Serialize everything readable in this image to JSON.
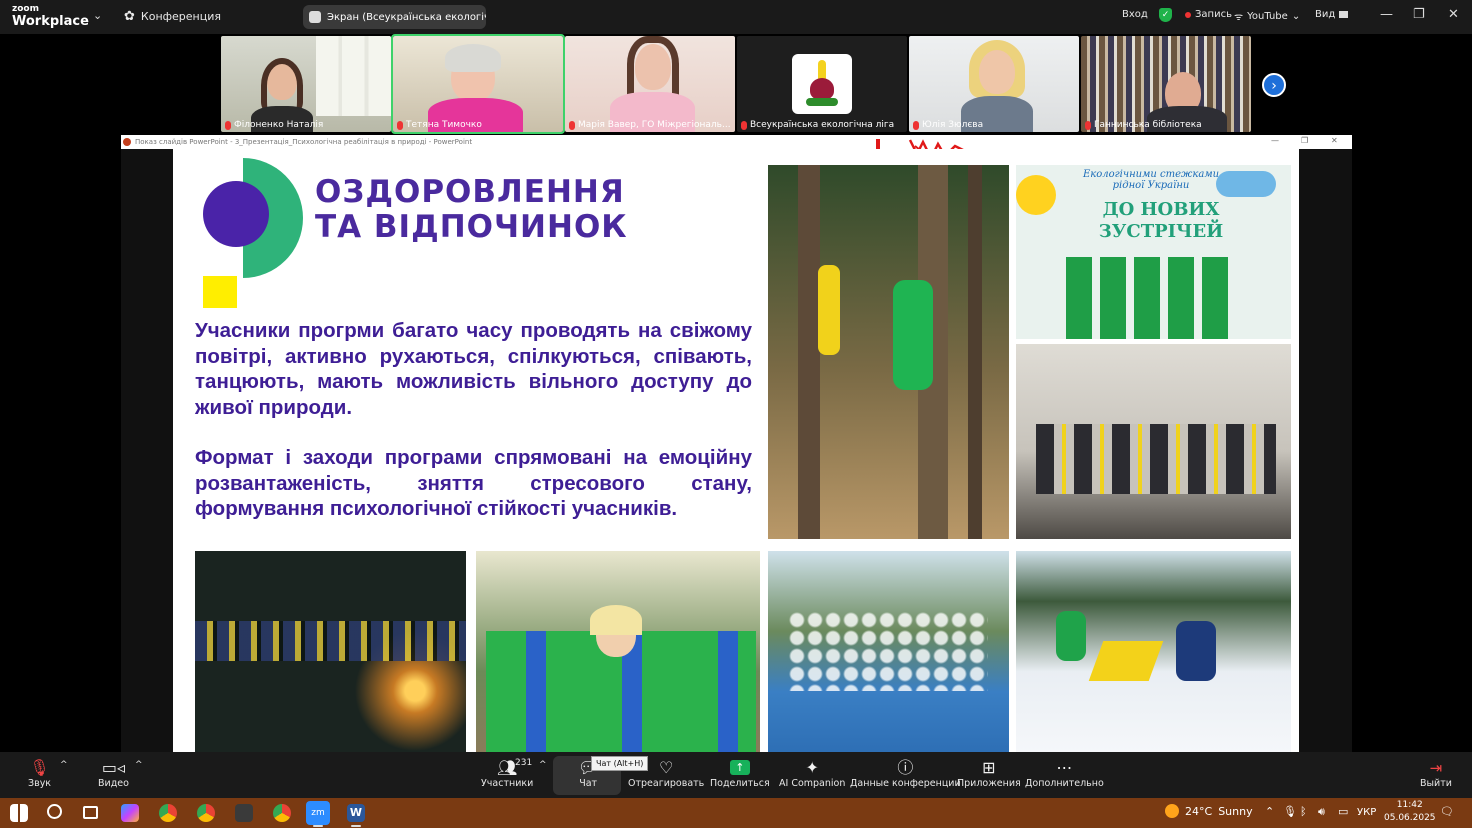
{
  "zoom_logo": {
    "line1": "zoom",
    "line2": "Workplace"
  },
  "conference_label": "Конференция",
  "screen_share_pill": "Экран (Всеукраїнська екологічн",
  "top_right": {
    "signin": "Вход",
    "record": "Запись",
    "youtube": "YouTube",
    "view": "Вид"
  },
  "participants_strip": [
    {
      "name": "Філоненко Наталія"
    },
    {
      "name": "Тетяна Тимочко"
    },
    {
      "name": "Марія Вавер, ГО Міжрегіональ..."
    },
    {
      "name": "Всеукраїнська екологічна ліга"
    },
    {
      "name": "Юлія Зюлєва"
    },
    {
      "name": "Ганнинська бібліотека"
    }
  ],
  "ppt_window_title": "Показ слайдів PowerPoint  -  3_Презентація_Психологічна реабілітація в природі  -  PowerPoint",
  "slide": {
    "title_line1": "ОЗДОРОВЛЕННЯ",
    "title_line2": "ТА ВІДПОЧИНОК",
    "paragraph1": "Учасники прогрми  багато часу проводять на свіжому повітрі, активно рухаються, спілкуються, співають, танцюють, мають можливість вільного доступу до живої природи.",
    "paragraph2": "Формат і заходи програми спрямовані на емоційну розвантаженість, зняття стресового стану, формування психологічної стійкості учасників.",
    "banner_line1": "Екологічними стежками",
    "banner_line2": "рідної України",
    "banner_line3": "ДО НОВИХ",
    "banner_line4": "ЗУСТРІЧЕЙ"
  },
  "toolbar": {
    "audio": "Звук",
    "video": "Видео",
    "participants": "Участники",
    "participants_count": "231",
    "chat": "Чат",
    "chat_tooltip": "Чат (Alt+H)",
    "react": "Отреагировать",
    "share": "Поделиться",
    "ai": "AI Companion",
    "info": "Данные конференции",
    "apps": "Приложения",
    "more": "Дополнительно",
    "leave": "Выйти"
  },
  "taskbar": {
    "temperature": "24°C",
    "weather": "Sunny",
    "lang": "УКР",
    "time": "11:42",
    "date": "05.06.2025"
  },
  "colors": {
    "title_purple": "#4a2a9e",
    "text_purple": "#3e1e95",
    "logo_green": "#2fb37a",
    "logo_yellow": "#ffee00",
    "zoom_green": "#3ed26a",
    "taskbar": "#7a3a12"
  }
}
